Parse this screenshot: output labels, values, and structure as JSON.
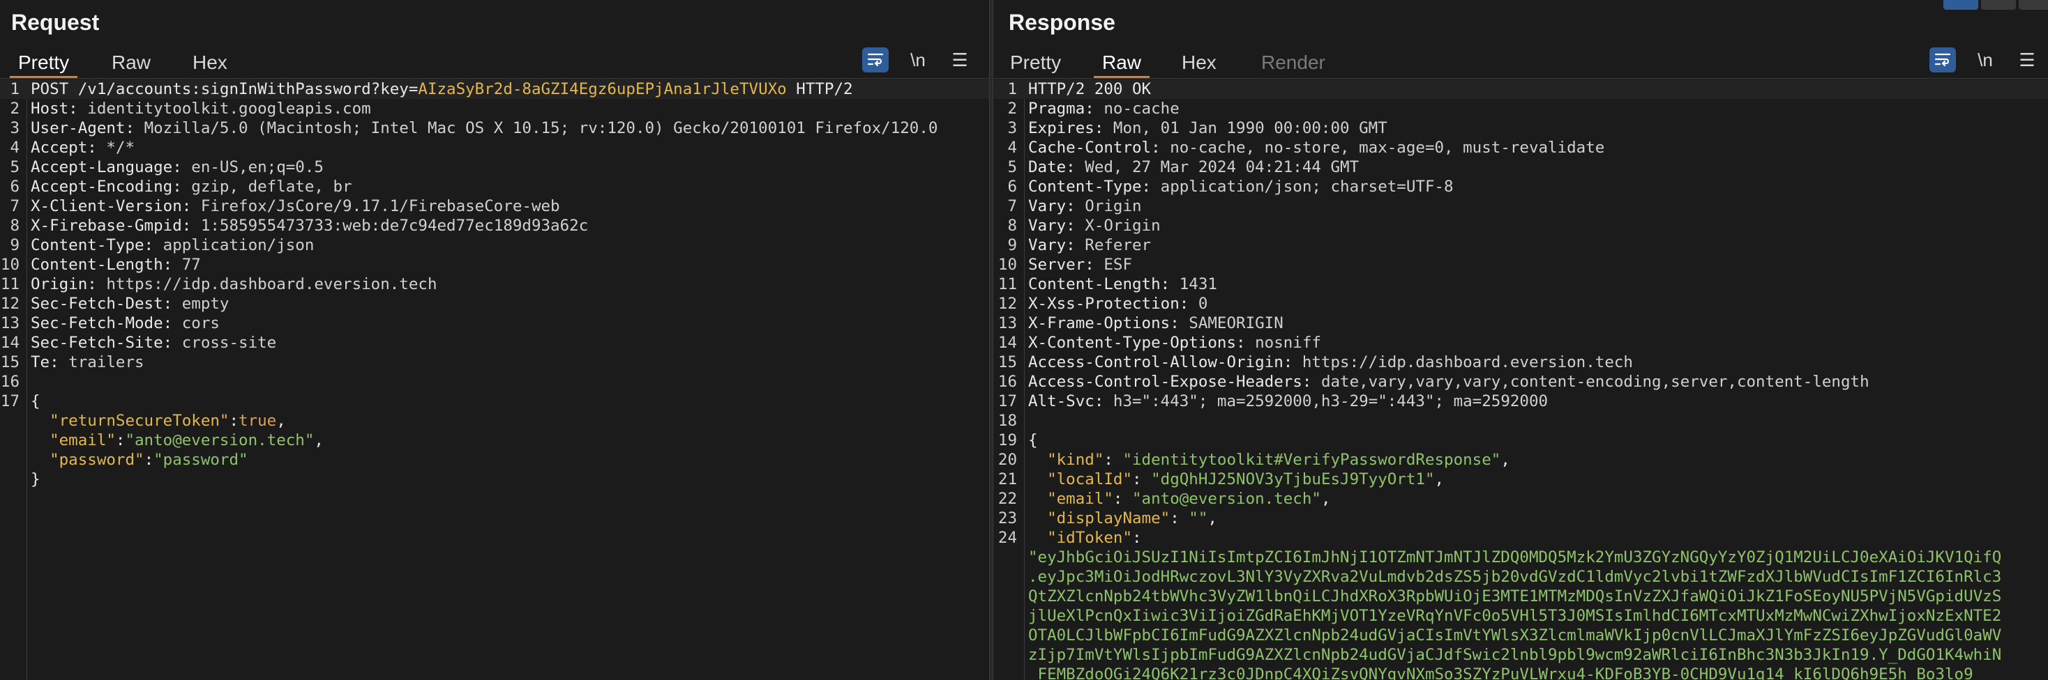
{
  "request": {
    "title": "Request",
    "tabs": [
      "Pretty",
      "Raw",
      "Hex"
    ],
    "active_tab": "Pretty",
    "tools": {
      "wrap_icon": "wrap-lines-icon",
      "newline": "\\n",
      "menu_icon": "hamburger-menu-icon"
    },
    "lines": [
      {
        "n": "1",
        "parts": [
          {
            "t": "POST /v1/accounts:signInWithPassword?",
            "c": "k"
          },
          {
            "t": "key",
            "c": "k"
          },
          {
            "t": "=",
            "c": "k"
          },
          {
            "t": "AIzaSyBr2d-8aGZI4Egz6upEPjAna1rJleTVUXo",
            "c": "jkey"
          },
          {
            "t": " HTTP/2",
            "c": "k"
          }
        ]
      },
      {
        "n": "2",
        "parts": [
          {
            "t": "Host: ",
            "c": "k"
          },
          {
            "t": "identitytoolkit.googleapis.com",
            "c": "v"
          }
        ]
      },
      {
        "n": "3",
        "parts": [
          {
            "t": "User-Agent: ",
            "c": "k"
          },
          {
            "t": "Mozilla/5.0 (Macintosh; Intel Mac OS X 10.15; rv:120.0) Gecko/20100101 Firefox/120.0",
            "c": "v"
          }
        ]
      },
      {
        "n": "4",
        "parts": [
          {
            "t": "Accept: ",
            "c": "k"
          },
          {
            "t": "*/*",
            "c": "v"
          }
        ]
      },
      {
        "n": "5",
        "parts": [
          {
            "t": "Accept-Language: ",
            "c": "k"
          },
          {
            "t": "en-US,en;q=0.5",
            "c": "v"
          }
        ]
      },
      {
        "n": "6",
        "parts": [
          {
            "t": "Accept-Encoding: ",
            "c": "k"
          },
          {
            "t": "gzip, deflate, br",
            "c": "v"
          }
        ]
      },
      {
        "n": "7",
        "parts": [
          {
            "t": "X-Client-Version: ",
            "c": "k"
          },
          {
            "t": "Firefox/JsCore/9.17.1/FirebaseCore-web",
            "c": "v"
          }
        ]
      },
      {
        "n": "8",
        "parts": [
          {
            "t": "X-Firebase-Gmpid: ",
            "c": "k"
          },
          {
            "t": "1:585955473733:web:de7c94ed77ec189d93a62c",
            "c": "v"
          }
        ]
      },
      {
        "n": "9",
        "parts": [
          {
            "t": "Content-Type: ",
            "c": "k"
          },
          {
            "t": "application/json",
            "c": "v"
          }
        ]
      },
      {
        "n": "10",
        "parts": [
          {
            "t": "Content-Length: ",
            "c": "k"
          },
          {
            "t": "77",
            "c": "v"
          }
        ]
      },
      {
        "n": "11",
        "parts": [
          {
            "t": "Origin: ",
            "c": "k"
          },
          {
            "t": "https://idp.dashboard.eversion.tech",
            "c": "v"
          }
        ]
      },
      {
        "n": "12",
        "parts": [
          {
            "t": "Sec-Fetch-Dest: ",
            "c": "k"
          },
          {
            "t": "empty",
            "c": "v"
          }
        ]
      },
      {
        "n": "13",
        "parts": [
          {
            "t": "Sec-Fetch-Mode: ",
            "c": "k"
          },
          {
            "t": "cors",
            "c": "v"
          }
        ]
      },
      {
        "n": "14",
        "parts": [
          {
            "t": "Sec-Fetch-Site: ",
            "c": "k"
          },
          {
            "t": "cross-site",
            "c": "v"
          }
        ]
      },
      {
        "n": "15",
        "parts": [
          {
            "t": "Te: ",
            "c": "k"
          },
          {
            "t": "trailers",
            "c": "v"
          }
        ]
      },
      {
        "n": "16",
        "parts": []
      },
      {
        "n": "17",
        "parts": [
          {
            "t": "{",
            "c": "jpunc"
          }
        ]
      },
      {
        "n": "",
        "parts": [
          {
            "t": "  ",
            "c": "jpunc"
          },
          {
            "t": "\"returnSecureToken\"",
            "c": "jkey"
          },
          {
            "t": ":",
            "c": "jpunc"
          },
          {
            "t": "true",
            "c": "jbool"
          },
          {
            "t": ",",
            "c": "jpunc"
          }
        ]
      },
      {
        "n": "",
        "parts": [
          {
            "t": "  ",
            "c": "jpunc"
          },
          {
            "t": "\"email\"",
            "c": "jkey"
          },
          {
            "t": ":",
            "c": "jpunc"
          },
          {
            "t": "\"anto@eversion.tech\"",
            "c": "jstr"
          },
          {
            "t": ",",
            "c": "jpunc"
          }
        ]
      },
      {
        "n": "",
        "parts": [
          {
            "t": "  ",
            "c": "jpunc"
          },
          {
            "t": "\"password\"",
            "c": "jkey"
          },
          {
            "t": ":",
            "c": "jpunc"
          },
          {
            "t": "\"password\"",
            "c": "jstr"
          }
        ]
      },
      {
        "n": "",
        "parts": [
          {
            "t": "}",
            "c": "jpunc"
          }
        ]
      }
    ]
  },
  "response": {
    "title": "Response",
    "tabs": [
      "Pretty",
      "Raw",
      "Hex",
      "Render"
    ],
    "active_tab": "Raw",
    "tools": {
      "wrap_icon": "wrap-lines-icon",
      "newline": "\\n",
      "menu_icon": "hamburger-menu-icon"
    },
    "lines": [
      {
        "n": "1",
        "parts": [
          {
            "t": "HTTP/2 200 OK",
            "c": "k"
          }
        ]
      },
      {
        "n": "2",
        "parts": [
          {
            "t": "Pragma: ",
            "c": "k"
          },
          {
            "t": "no-cache",
            "c": "v"
          }
        ]
      },
      {
        "n": "3",
        "parts": [
          {
            "t": "Expires: ",
            "c": "k"
          },
          {
            "t": "Mon, 01 Jan 1990 00:00:00 GMT",
            "c": "v"
          }
        ]
      },
      {
        "n": "4",
        "parts": [
          {
            "t": "Cache-Control: ",
            "c": "k"
          },
          {
            "t": "no-cache, no-store, max-age=0, must-revalidate",
            "c": "v"
          }
        ]
      },
      {
        "n": "5",
        "parts": [
          {
            "t": "Date: ",
            "c": "k"
          },
          {
            "t": "Wed, 27 Mar 2024 04:21:44 GMT",
            "c": "v"
          }
        ]
      },
      {
        "n": "6",
        "parts": [
          {
            "t": "Content-Type: ",
            "c": "k"
          },
          {
            "t": "application/json; charset=UTF-8",
            "c": "v"
          }
        ]
      },
      {
        "n": "7",
        "parts": [
          {
            "t": "Vary: ",
            "c": "k"
          },
          {
            "t": "Origin",
            "c": "v"
          }
        ]
      },
      {
        "n": "8",
        "parts": [
          {
            "t": "Vary: ",
            "c": "k"
          },
          {
            "t": "X-Origin",
            "c": "v"
          }
        ]
      },
      {
        "n": "9",
        "parts": [
          {
            "t": "Vary: ",
            "c": "k"
          },
          {
            "t": "Referer",
            "c": "v"
          }
        ]
      },
      {
        "n": "10",
        "parts": [
          {
            "t": "Server: ",
            "c": "k"
          },
          {
            "t": "ESF",
            "c": "v"
          }
        ]
      },
      {
        "n": "11",
        "parts": [
          {
            "t": "Content-Length: ",
            "c": "k"
          },
          {
            "t": "1431",
            "c": "v"
          }
        ]
      },
      {
        "n": "12",
        "parts": [
          {
            "t": "X-Xss-Protection: ",
            "c": "k"
          },
          {
            "t": "0",
            "c": "v"
          }
        ]
      },
      {
        "n": "13",
        "parts": [
          {
            "t": "X-Frame-Options: ",
            "c": "k"
          },
          {
            "t": "SAMEORIGIN",
            "c": "v"
          }
        ]
      },
      {
        "n": "14",
        "parts": [
          {
            "t": "X-Content-Type-Options: ",
            "c": "k"
          },
          {
            "t": "nosniff",
            "c": "v"
          }
        ]
      },
      {
        "n": "15",
        "parts": [
          {
            "t": "Access-Control-Allow-Origin: ",
            "c": "k"
          },
          {
            "t": "https://idp.dashboard.eversion.tech",
            "c": "v"
          }
        ]
      },
      {
        "n": "16",
        "parts": [
          {
            "t": "Access-Control-Expose-Headers: ",
            "c": "k"
          },
          {
            "t": "date,vary,vary,vary,content-encoding,server,content-length",
            "c": "v"
          }
        ]
      },
      {
        "n": "17",
        "parts": [
          {
            "t": "Alt-Svc: ",
            "c": "k"
          },
          {
            "t": "h3=\":443\"; ma=2592000,h3-29=\":443\"; ma=2592000",
            "c": "v"
          }
        ]
      },
      {
        "n": "18",
        "parts": []
      },
      {
        "n": "19",
        "parts": [
          {
            "t": "{",
            "c": "jpunc"
          }
        ]
      },
      {
        "n": "20",
        "parts": [
          {
            "t": "  ",
            "c": "jpunc"
          },
          {
            "t": "\"kind\"",
            "c": "jkey"
          },
          {
            "t": ": ",
            "c": "jpunc"
          },
          {
            "t": "\"identitytoolkit#VerifyPasswordResponse\"",
            "c": "jstr"
          },
          {
            "t": ",",
            "c": "jpunc"
          }
        ]
      },
      {
        "n": "21",
        "parts": [
          {
            "t": "  ",
            "c": "jpunc"
          },
          {
            "t": "\"localId\"",
            "c": "jkey"
          },
          {
            "t": ": ",
            "c": "jpunc"
          },
          {
            "t": "\"dgQhHJ25NOV3yTjbuEsJ9TyyOrt1\"",
            "c": "jstr"
          },
          {
            "t": ",",
            "c": "jpunc"
          }
        ]
      },
      {
        "n": "22",
        "parts": [
          {
            "t": "  ",
            "c": "jpunc"
          },
          {
            "t": "\"email\"",
            "c": "jkey"
          },
          {
            "t": ": ",
            "c": "jpunc"
          },
          {
            "t": "\"anto@eversion.tech\"",
            "c": "jstr"
          },
          {
            "t": ",",
            "c": "jpunc"
          }
        ]
      },
      {
        "n": "23",
        "parts": [
          {
            "t": "  ",
            "c": "jpunc"
          },
          {
            "t": "\"displayName\"",
            "c": "jkey"
          },
          {
            "t": ": ",
            "c": "jpunc"
          },
          {
            "t": "\"\"",
            "c": "jstr"
          },
          {
            "t": ",",
            "c": "jpunc"
          }
        ]
      },
      {
        "n": "24",
        "parts": [
          {
            "t": "  ",
            "c": "jpunc"
          },
          {
            "t": "\"idToken\"",
            "c": "jkey"
          },
          {
            "t": ":",
            "c": "jpunc"
          }
        ]
      }
    ],
    "token_lines": [
      "\"eyJhbGciOiJSUzI1NiIsImtpZCI6ImJhNjI1OTZmNTJmNTJlZDQ0MDQ5Mzk2YmU3ZGYzNGQyYzY0ZjQ1M2UiLCJ0eXAiOiJKV1QifQ",
      ".eyJpc3MiOiJodHRwczovL3NlY3VyZXRva2VuLmdvb2dsZS5jb20vdGVzdC1ldmVyc2lvbi1tZWFzdXJlbWVudCIsImF1ZCI6InRlc3",
      "QtZXZlcnNpb24tbWVhc3VyZW1lbnQiLCJhdXRoX3RpbWUiOjE3MTE1MTMzMDQsInVzZXJfaWQiOiJkZ1FoSEoyNU5PVjN5VGpidUVzS",
      "jlUeXlPcnQxIiwic3ViIjoiZGdRaEhKMjVOT1YzeVRqYnVFc0o5VHl5T3J0MSIsImlhdCI6MTcxMTUxMzMwNCwiZXhwIjoxNzExNTE2",
      "OTA0LCJlbWFpbCI6ImFudG9AZXZlcnNpb24udGVjaCIsImVtYWlsX3ZlcmlmaWVkIjp0cnVlLCJmaXJlYmFzZSI6eyJpZGVudGl0aWV",
      "zIjp7ImVtYWlsIjpbImFudG9AZXZlcnNpb24udGVjaCJdfSwic2lnbl9pbl9wcm92aWRlciI6InBhc3N3b3JkIn19.Y_DdGO1K4whiN",
      "_FEMBZdoOGi24Q6K21rz3c0JDnpC4XQiZsvQNYgvNXmSo3SZYzPuVLWrxu4-KDFoB3YB-0CHD9Vu1g14_kI6lDQ6h9E5h_Bo3lo9"
    ]
  }
}
